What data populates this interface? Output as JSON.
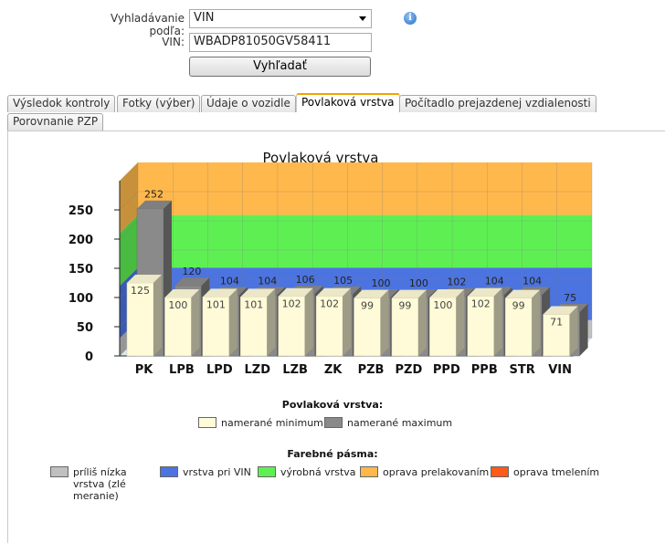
{
  "search": {
    "by_label": "Vyhladávanie podľa:",
    "by_value": "VIN",
    "vin_label": "VIN:",
    "vin_value": "WBADP81050GV58411",
    "search_button": "Vyhľadať",
    "info_icon": "info-icon"
  },
  "tabs": [
    {
      "label": "Výsledok kontroly",
      "active": false
    },
    {
      "label": "Fotky (výber)",
      "active": false
    },
    {
      "label": "Údaje o vozidle",
      "active": false
    },
    {
      "label": "Povlaková vrstva",
      "active": true
    },
    {
      "label": "Počítadlo prejazdenej vzdialenosti",
      "active": false
    },
    {
      "label": "Porovnanie PZP",
      "active": false
    }
  ],
  "chart_data": {
    "type": "bar",
    "title": "Povlaková vrstva",
    "categories": [
      "PK",
      "LPB",
      "LPD",
      "LZD",
      "LZB",
      "ZK",
      "PZB",
      "PZD",
      "PPD",
      "PPB",
      "STR",
      "VIN"
    ],
    "series": [
      {
        "name": "namerané minimum",
        "values": [
          125,
          100,
          101,
          101,
          102,
          102,
          99,
          99,
          100,
          102,
          99,
          71
        ],
        "color": "#fffbd8"
      },
      {
        "name": "namerané maximum",
        "values": [
          252,
          120,
          104,
          104,
          106,
          105,
          100,
          100,
          102,
          104,
          104,
          75
        ],
        "color": "#8a8a8a"
      }
    ],
    "y_ticks": [
      0,
      50,
      100,
      150,
      200,
      250
    ],
    "ylim": [
      0,
      300
    ],
    "bands": [
      {
        "from": 0,
        "to": 30,
        "color": "#c0c0c0"
      },
      {
        "from": 30,
        "to": 120,
        "color": "#4c74e0"
      },
      {
        "from": 120,
        "to": 210,
        "color": "#5ef053"
      },
      {
        "from": 210,
        "to": 300,
        "color": "#ffb84c"
      }
    ],
    "grid": true
  },
  "legend_series": {
    "title": "Povlaková vrstva:",
    "items": [
      {
        "label": "namerané minimum",
        "color": "#fffbd8"
      },
      {
        "label": "namerané maximum",
        "color": "#8a8a8a"
      }
    ]
  },
  "legend_bands": {
    "title": "Farebné pásma:",
    "items": [
      {
        "label": "príliš nízka vrstva (zlé meranie)",
        "color": "#c0c0c0"
      },
      {
        "label": "vrstva pri VIN",
        "color": "#4c74e0"
      },
      {
        "label": "výrobná vrstva",
        "color": "#5ef053"
      },
      {
        "label": "oprava prelakovaním",
        "color": "#ffb84c"
      },
      {
        "label": "oprava tmelením",
        "color": "#ff5a1a"
      }
    ]
  }
}
